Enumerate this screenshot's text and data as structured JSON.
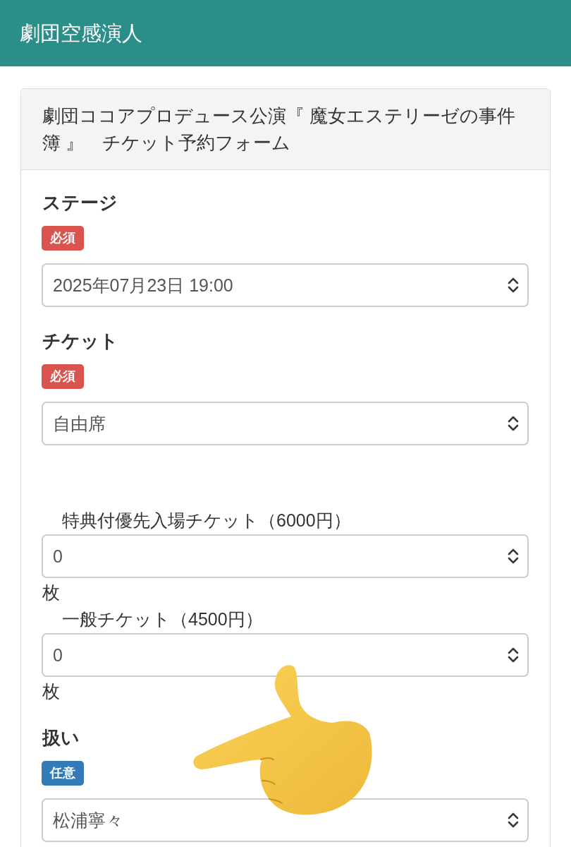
{
  "header": {
    "title": "劇団空感演人"
  },
  "form": {
    "title": "劇団ココアプロデュース公演『 魔女エステリーゼの事件簿 』　チケット予約フォーム",
    "fields": [
      {
        "kind": "select",
        "label": "ステージ",
        "badge": {
          "text": "必須",
          "kind": "required"
        },
        "value": "2025年07月23日 19:00"
      },
      {
        "kind": "select",
        "label": "チケット",
        "badge": {
          "text": "必須",
          "kind": "required"
        },
        "value": "自由席"
      },
      {
        "kind": "quantity",
        "label": "特典付優先入場チケット（6000円）",
        "value": "0",
        "unit": "枚"
      },
      {
        "kind": "quantity",
        "label": "一般チケット（4500円）",
        "value": "0",
        "unit": "枚"
      },
      {
        "kind": "select",
        "label": "扱い",
        "badge": {
          "text": "任意",
          "kind": "optional"
        },
        "value": "松浦寧々"
      }
    ]
  }
}
